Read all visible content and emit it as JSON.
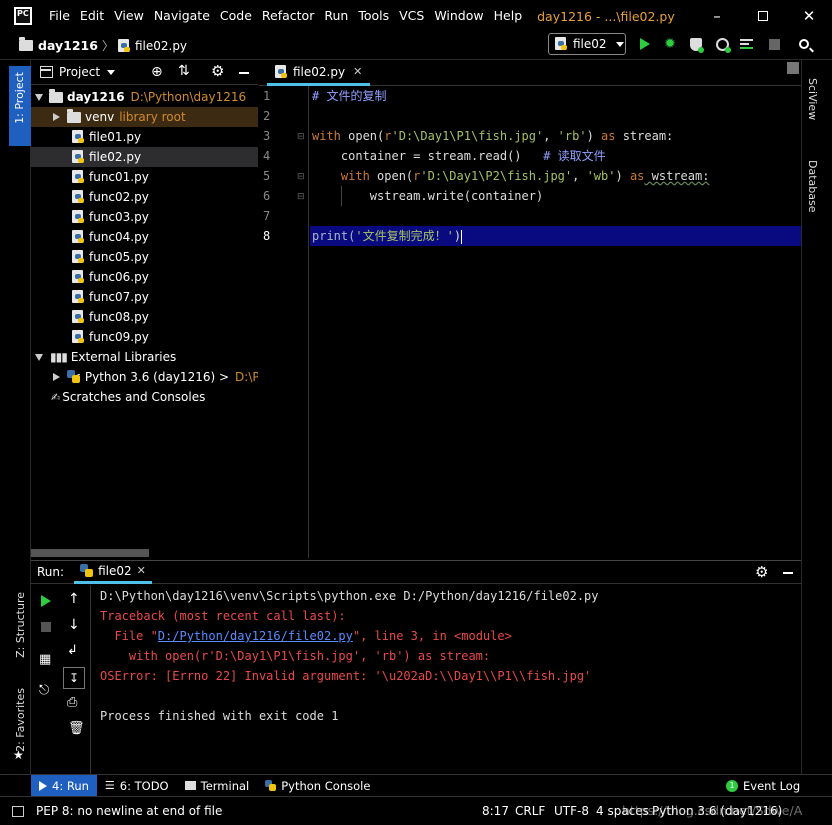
{
  "menu": [
    "File",
    "Edit",
    "View",
    "Navigate",
    "Code",
    "Refactor",
    "Run",
    "Tools",
    "VCS",
    "Window",
    "Help"
  ],
  "app_logo_text": "PC",
  "window_title": "day1216 - ...\\file02.py",
  "breadcrumb": {
    "project": "day1216",
    "file": "file02.py"
  },
  "run_config": "file02",
  "project_panel": {
    "title": "Project",
    "root": {
      "name": "day1216",
      "path": "D:\\Python\\day1216"
    },
    "venv": {
      "name": "venv",
      "tag": "library root"
    },
    "files": [
      "file01.py",
      "file02.py",
      "func01.py",
      "func02.py",
      "func03.py",
      "func04.py",
      "func05.py",
      "func06.py",
      "func07.py",
      "func08.py",
      "func09.py"
    ],
    "selected_file": "file02.py",
    "external_libraries": "External Libraries",
    "python_sdk": "< Python 3.6 (day1216) >",
    "python_sdk_path": "D:\\Pyt",
    "scratches": "Scratches and Consoles"
  },
  "left_stripe": {
    "project": "1: Project",
    "structure": "Z: Structure",
    "favorites": "2: Favorites"
  },
  "right_stripe": {
    "sciview": "SciView",
    "database": "Database"
  },
  "editor": {
    "tab": "file02.py",
    "line_numbers": [
      "1",
      "2",
      "3",
      "4",
      "5",
      "6",
      "7",
      "8"
    ],
    "current_line": 8,
    "lines": {
      "l1_comment": "# 文件的复制",
      "l3_with": "with",
      "l3_open": " open(",
      "l3_r": "r",
      "l3_path": "'D:\\Day1\\P1\\fish.jpg'",
      "l3_sep": ", ",
      "l3_mode": "'rb'",
      "l3_close": ") ",
      "l3_as": "as",
      "l3_var": " stream:",
      "l4_code": "    container = stream.read()   ",
      "l4_comment": "# 读取文件",
      "l5_indent": "    ",
      "l5_with": "with",
      "l5_open": " open(",
      "l5_r": "r",
      "l5_path": "'D:\\Day1\\P2\\fish.jpg'",
      "l5_sep": ", ",
      "l5_mode": "'wb'",
      "l5_close": ") ",
      "l5_as": "as",
      "l5_var": " wstream:",
      "l6_code": "        wstream.write(container)",
      "l8_print": "print(",
      "l8_str": "'文件复制完成！'",
      "l8_close": ")"
    }
  },
  "run_panel": {
    "label": "Run:",
    "tab": "file02",
    "console": {
      "cmd": "D:\\Python\\day1216\\venv\\Scripts\\python.exe D:/Python/day1216/file02.py",
      "tb": "Traceback (most recent call last):",
      "file_pre": "  File \"",
      "file_link": "D:/Python/day1216/file02.py",
      "file_post": "\", line 3, in <module>",
      "src": "    with open(r'D:\\Day1\\P1\\fish.jpg', 'rb') as stream:",
      "error": "OSError: [Errno 22] Invalid argument: '\\u202aD:\\\\Day1\\\\P1\\\\fish.jpg'",
      "finish": "Process finished with exit code 1"
    }
  },
  "tool_tabs": {
    "run": "4: Run",
    "todo": "6: TODO",
    "terminal": "Terminal",
    "python_console": "Python Console",
    "event_log": "Event Log"
  },
  "status": {
    "message": "PEP 8: no newline at end of file",
    "position": "8:17",
    "line_sep": "CRLF",
    "encoding": "UTF-8",
    "indent": "4 spaces",
    "interpreter": "Python 3.6 (day1216)",
    "watermark": "https://blog.csdn.net/Sdwe/A"
  },
  "colors": {
    "accent": "#4fc1e9",
    "selected_row": "#2d2d30",
    "venv_bg": "#3d2a12",
    "current_line": "#0a0a80",
    "error": "#e84a4a",
    "path_orange": "#d08a2c"
  }
}
